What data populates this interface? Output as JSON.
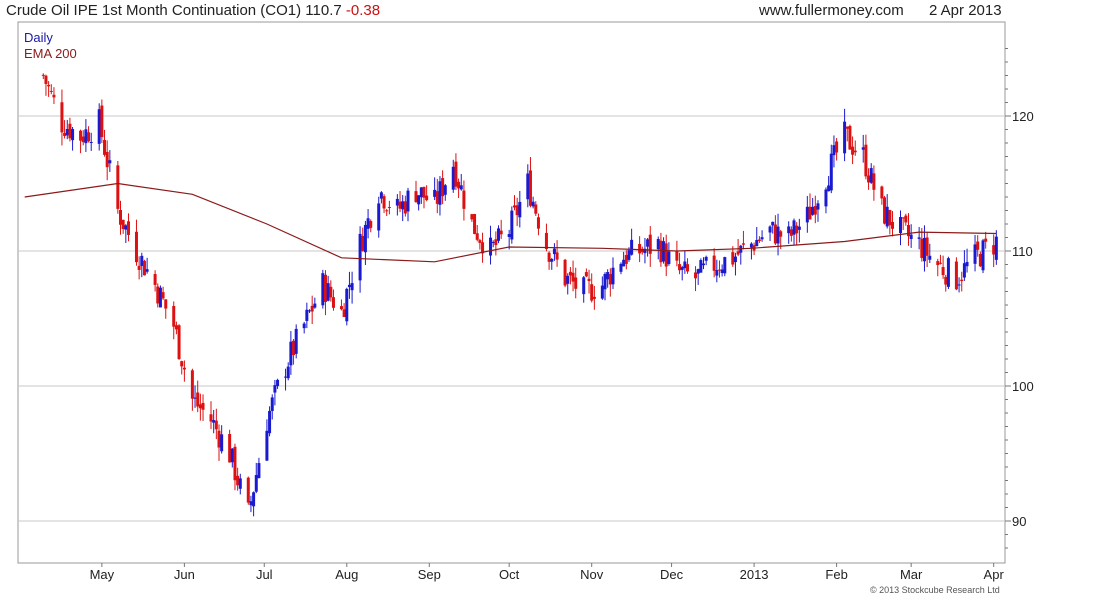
{
  "header": {
    "title": "Crude Oil IPE 1st Month Continuation (CO1) 110.7",
    "change": "-0.38",
    "site": "www.fullermoney.com",
    "date": "2 Apr 2013"
  },
  "legend": {
    "daily": "Daily",
    "ema": "EMA 200"
  },
  "copyright": "© 2013 Stockcube Research Ltd",
  "colors": {
    "up": "#1a1ad0",
    "down": "#dd1111",
    "ema": "#8b1a1a",
    "grid": "#c8c8c8"
  },
  "chart_data": {
    "type": "candlestick",
    "x_tick_labels": [
      "May",
      "Jun",
      "Jul",
      "Aug",
      "Sep",
      "Oct",
      "Nov",
      "Dec",
      "2013",
      "Feb",
      "Mar",
      "Apr"
    ],
    "y_ticks": [
      90,
      100,
      110,
      120
    ],
    "ylim": [
      87,
      126
    ],
    "grid": true,
    "y_axis_position": "right",
    "series": [
      {
        "name": "Daily",
        "x": [
          "2012-04-09",
          "2012-04-16",
          "2012-04-23",
          "2012-04-30",
          "2012-05-07",
          "2012-05-14",
          "2012-05-21",
          "2012-05-28",
          "2012-06-04",
          "2012-06-11",
          "2012-06-18",
          "2012-06-25",
          "2012-07-02",
          "2012-07-09",
          "2012-07-16",
          "2012-07-23",
          "2012-07-30",
          "2012-08-06",
          "2012-08-13",
          "2012-08-20",
          "2012-08-27",
          "2012-09-03",
          "2012-09-10",
          "2012-09-17",
          "2012-09-24",
          "2012-10-01",
          "2012-10-08",
          "2012-10-15",
          "2012-10-22",
          "2012-10-29",
          "2012-11-05",
          "2012-11-12",
          "2012-11-19",
          "2012-11-26",
          "2012-12-03",
          "2012-12-10",
          "2012-12-17",
          "2012-12-24",
          "2012-12-31",
          "2013-01-07",
          "2013-01-14",
          "2013-01-21",
          "2013-01-28",
          "2013-02-04",
          "2013-02-11",
          "2013-02-18",
          "2013-02-25",
          "2013-03-04",
          "2013-03-11",
          "2013-03-18",
          "2013-03-25",
          "2013-04-02"
        ],
        "values": [
          123.0,
          119.5,
          118.5,
          119.5,
          113.0,
          110.0,
          107.5,
          104.5,
          99.0,
          97.5,
          95.0,
          90.5,
          97.5,
          101.5,
          104.5,
          107.5,
          105.5,
          110.5,
          114.5,
          113.0,
          114.5,
          113.5,
          116.5,
          112.0,
          110.0,
          111.5,
          115.0,
          110.5,
          108.0,
          107.0,
          107.5,
          109.5,
          110.0,
          110.5,
          108.5,
          108.0,
          109.0,
          109.5,
          110.5,
          111.5,
          111.0,
          112.5,
          115.5,
          118.5,
          117.0,
          113.0,
          111.5,
          110.5,
          109.0,
          108.0,
          109.5,
          110.7
        ],
        "color": "#1a1ad0"
      },
      {
        "name": "EMA 200",
        "x": [
          "2012-04-02",
          "2012-05-07",
          "2012-06-04",
          "2012-07-02",
          "2012-07-30",
          "2012-09-03",
          "2012-10-01",
          "2012-11-05",
          "2012-12-03",
          "2012-12-31",
          "2013-02-04",
          "2013-03-04",
          "2013-04-02"
        ],
        "values": [
          114.0,
          115.0,
          114.2,
          112.0,
          109.5,
          109.2,
          110.3,
          110.2,
          110.0,
          110.2,
          110.7,
          111.4,
          111.3
        ],
        "color": "#8b1a1a"
      }
    ]
  }
}
